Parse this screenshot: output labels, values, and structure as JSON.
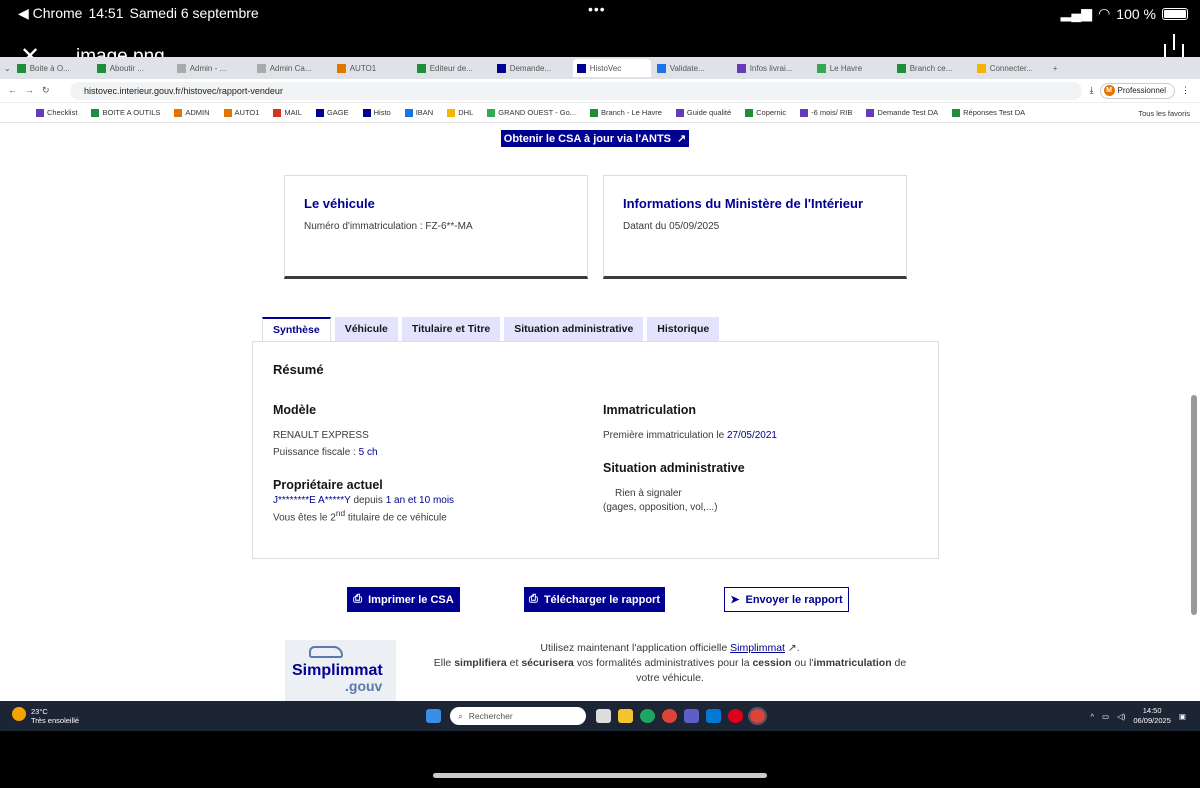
{
  "ios": {
    "app": "◀ Chrome",
    "time": "14:51",
    "date": "Samedi 6 septembre",
    "battery": "100 %"
  },
  "viewer": {
    "filename": "image.png"
  },
  "browser": {
    "tabs": [
      "Boite à O...",
      "Aboutir ...",
      "Admin - ...",
      "Admin Ca...",
      "AUTO1",
      "Editeur de...",
      "Demande...",
      "HistoVec",
      "Validate...",
      "Infos livrai...",
      "Le Havre",
      "Branch ce...",
      "Connecter..."
    ],
    "url": "histovec.interieur.gouv.fr/histovec/rapport-vendeur",
    "profile": "Professionnel",
    "bookmarks": [
      "Checklist",
      "BOITE A OUTILS",
      "ADMIN",
      "AUTO1",
      "MAIL",
      "GAGE",
      "Histo",
      "IBAN",
      "DHL",
      "GRAND OUEST - Go...",
      "Branch - Le Havre",
      "Guide qualité",
      "Copernic",
      "-6 mois/ RIB",
      "Demande Test DA",
      "Réponses Test DA"
    ],
    "all_bookmarks": "Tous les favoris"
  },
  "page": {
    "ants_button": "Obtenir le CSA à jour via l'ANTS",
    "card_vehicle": {
      "title": "Le véhicule",
      "text": "Numéro d'immatriculation : FZ-6**-MA"
    },
    "card_ministry": {
      "title": "Informations du Ministère de l'Intérieur",
      "text": "Datant du 05/09/2025"
    },
    "tabs": [
      "Synthèse",
      "Véhicule",
      "Titulaire et Titre",
      "Situation administrative",
      "Historique"
    ],
    "summary": {
      "heading": "Résumé",
      "model_heading": "Modèle",
      "model": "RENAULT EXPRESS",
      "power_label": "Puissance fiscale :",
      "power": "5 ch",
      "owner_heading": "Propriétaire actuel",
      "owner_name": "J********E A*****Y",
      "owner_since_label": "depuis",
      "owner_since": "1 an et 10 mois",
      "owner_rank_pre": "Vous êtes le",
      "owner_rank": "2",
      "owner_rank_sup": "nd",
      "owner_rank_post": "titulaire de ce véhicule",
      "reg_heading": "Immatriculation",
      "reg_label": "Première immatriculation le",
      "reg_date": "27/05/2021",
      "admin_heading": "Situation administrative",
      "admin_status": "Rien à signaler",
      "admin_note": "(gages, opposition, vol,...)"
    },
    "buttons": {
      "print": "Imprimer le CSA",
      "download": "Télécharger le rapport",
      "send": "Envoyer le rapport"
    },
    "promo": {
      "line1_pre": "Utilisez maintenant l'application officielle",
      "app_link": "Simplimmat",
      "line2_a": "Elle",
      "simplify": "simplifiera",
      "line2_b": "et",
      "secure": "sécurisera",
      "line2_c": "vos formalités administratives pour la",
      "cession": "cession",
      "line2_d": "ou l'",
      "immat": "immatriculation",
      "line2_e": "de votre véhicule."
    },
    "logo": {
      "name": "Simplimmat",
      "suffix": ".gouv"
    }
  },
  "taskbar": {
    "temp": "23°C",
    "weather": "Très ensoleillé",
    "search": "Rechercher",
    "time": "14:50",
    "date": "06/09/2025"
  },
  "colors": {
    "accent": "#000091",
    "tab_bg": "#e3e3fd"
  }
}
